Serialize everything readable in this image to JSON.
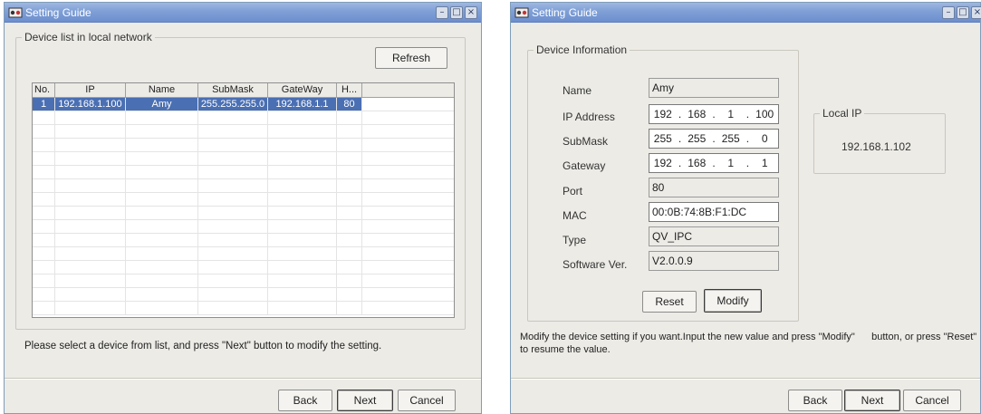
{
  "window1": {
    "title": "Setting Guide",
    "group_label": "Device list in local network",
    "refresh_label": "Refresh",
    "table": {
      "columns": [
        "No.",
        "IP",
        "Name",
        "SubMask",
        "GateWay",
        "H..."
      ],
      "rows": [
        [
          "1",
          "192.168.1.100",
          "Amy",
          "255.255.255.0",
          "192.168.1.1",
          "80"
        ]
      ]
    },
    "message": "Please select a device from list, and press \"Next\" button to modify the setting.",
    "back_label": "Back",
    "next_label": "Next",
    "cancel_label": "Cancel"
  },
  "window2": {
    "title": "Setting Guide",
    "group_label": "Device Information",
    "fields": {
      "name_label": "Name",
      "name_value": "Amy",
      "ip_label": "IP Address",
      "ip_octets": [
        "192",
        "168",
        "1",
        "100"
      ],
      "mask_label": "SubMask",
      "mask_octets": [
        "255",
        "255",
        "255",
        "0"
      ],
      "gateway_label": "Gateway",
      "gateway_octets": [
        "192",
        "168",
        "1",
        "1"
      ],
      "port_label": "Port",
      "port_value": "80",
      "mac_label": "MAC",
      "mac_value": "00:0B:74:8B:F1:DC",
      "type_label": "Type",
      "type_value": "QV_IPC",
      "software_label": "Software Ver.",
      "software_value": "V2.0.0.9"
    },
    "reset_label": "Reset",
    "modify_label": "Modify",
    "local_ip_label": "Local IP",
    "local_ip_value": "192.168.1.102",
    "message_line1": "Modify the device setting if you want.Input the new value and press \"Modify\"      button, or press \"Reset\"",
    "message_line2": "to resume the value.",
    "back_label": "Back",
    "next_label": "Next",
    "cancel_label": "Cancel"
  },
  "colors": {
    "titlebar": "#7f9fd6",
    "selection": "#4a6fb3",
    "dialog_bg": "#ecebe6"
  }
}
